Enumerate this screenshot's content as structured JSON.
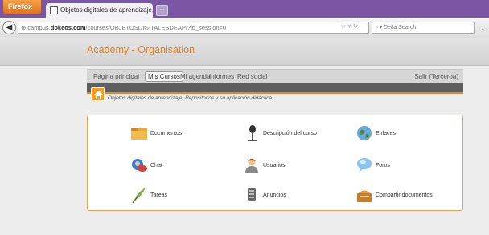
{
  "browser": {
    "app_button": "Firefox",
    "tab_title": "Objetos digitales de aprendizaje, Reposit...",
    "new_tab": "+",
    "url_prefix": "campus.",
    "url_domain": "dokeos.com",
    "url_path": "/courses/OBJETOSDIGITALESDEAP/?id_session=0",
    "search_placeholder": "Delta Search"
  },
  "site": {
    "title": "Academy - Organisation",
    "menu": [
      {
        "label": "Página principal"
      },
      {
        "label": "Mis Cursos"
      },
      {
        "label": "Mi agenda"
      },
      {
        "label": "Informes"
      },
      {
        "label": "Red social"
      }
    ],
    "logout": "Salir (Terceroa)",
    "breadcrumb": "Objetos digitales de aprendizaje, Repositorios y su aplicación didáctica",
    "accent": "#e8801c"
  },
  "tools": [
    {
      "label": "Documentos",
      "icon": "folder-icon"
    },
    {
      "label": "Descripción del curso",
      "icon": "microphone-icon"
    },
    {
      "label": "Enlaces",
      "icon": "globe-icon"
    },
    {
      "label": "Chat",
      "icon": "chat-icon"
    },
    {
      "label": "Usuarios",
      "icon": "user-icon"
    },
    {
      "label": "Foros",
      "icon": "forum-icon"
    },
    {
      "label": "Tareas",
      "icon": "quill-icon"
    },
    {
      "label": "Anuncios",
      "icon": "announcement-icon"
    },
    {
      "label": "Compartir documentos",
      "icon": "share-documents-icon"
    }
  ]
}
